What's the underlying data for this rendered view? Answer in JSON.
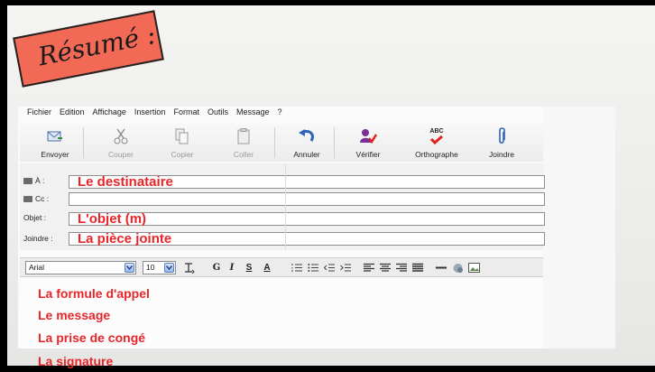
{
  "sticker": {
    "title": "Résumé :"
  },
  "menu": [
    "Fichier",
    "Edition",
    "Affichage",
    "Insertion",
    "Format",
    "Outils",
    "Message",
    "?"
  ],
  "toolbar": {
    "send": "Envoyer",
    "cut": "Couper",
    "copy": "Copier",
    "paste": "Coller",
    "undo": "Annuler",
    "check": "Vérifier",
    "spelling": "Orthographe",
    "spelling_badge": "ABC",
    "attach": "Joindre"
  },
  "fields": {
    "to_label": "À :",
    "to_value": "Le destinataire",
    "cc_label": "Cc :",
    "cc_value": "",
    "subject_label": "Objet :",
    "subject_value": "L'objet (m)",
    "attach_label": "Joindre :",
    "attach_value": "La pièce jointe"
  },
  "format": {
    "font": "Arial",
    "size": "10",
    "bold": "G",
    "italic": "I",
    "underline": "S",
    "color": "A"
  },
  "body": {
    "line1": "La formule d'appel",
    "line2": "Le message",
    "line3": "La prise de congé",
    "line4": "La signature"
  },
  "colors": {
    "accent_red": "#e8262a",
    "sticker": "#f26a55"
  }
}
